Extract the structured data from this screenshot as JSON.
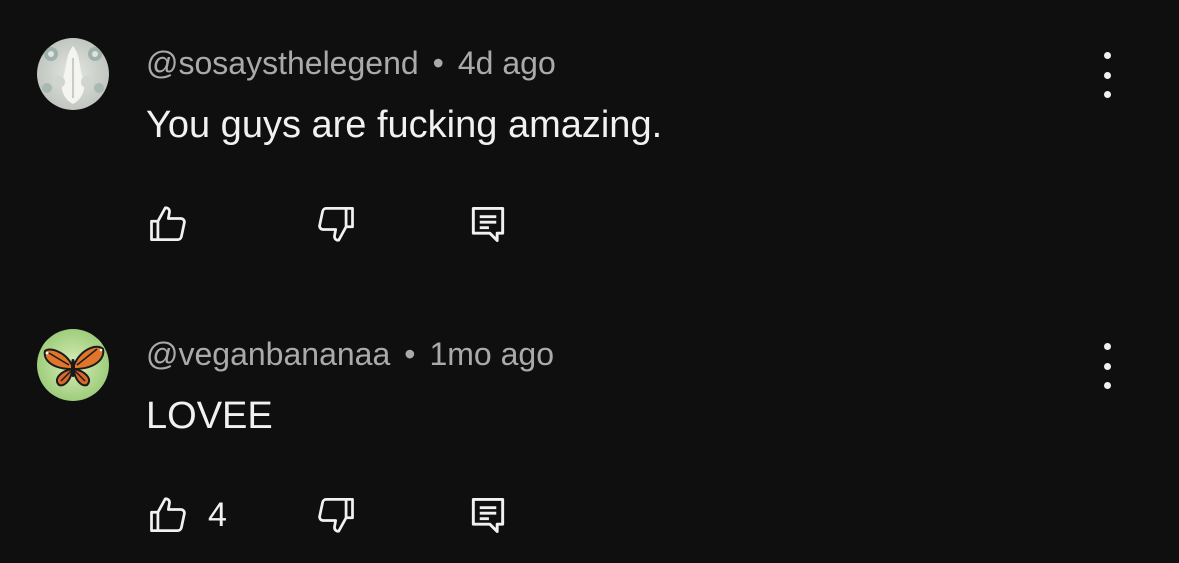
{
  "comments": [
    {
      "handle": "@sosaysthelegend",
      "separator": "•",
      "time": "4d ago",
      "text": "You guys are fucking amazing.",
      "like_count": "",
      "avatar_icon": "ornamental-sculpture-avatar",
      "menu_icon": "more-vert-icon"
    },
    {
      "handle": "@veganbananaa",
      "separator": "•",
      "time": "1mo ago",
      "text": "LOVEE",
      "like_count": "4",
      "avatar_icon": "monarch-butterfly-avatar",
      "menu_icon": "more-vert-icon"
    }
  ],
  "icons": {
    "like": "thumb-up-icon",
    "dislike": "thumb-down-icon",
    "reply": "comment-reply-icon"
  },
  "colors": {
    "background": "#0f0f0f",
    "primary_text": "#f1f1f1",
    "secondary_text": "#aaaaaa"
  }
}
